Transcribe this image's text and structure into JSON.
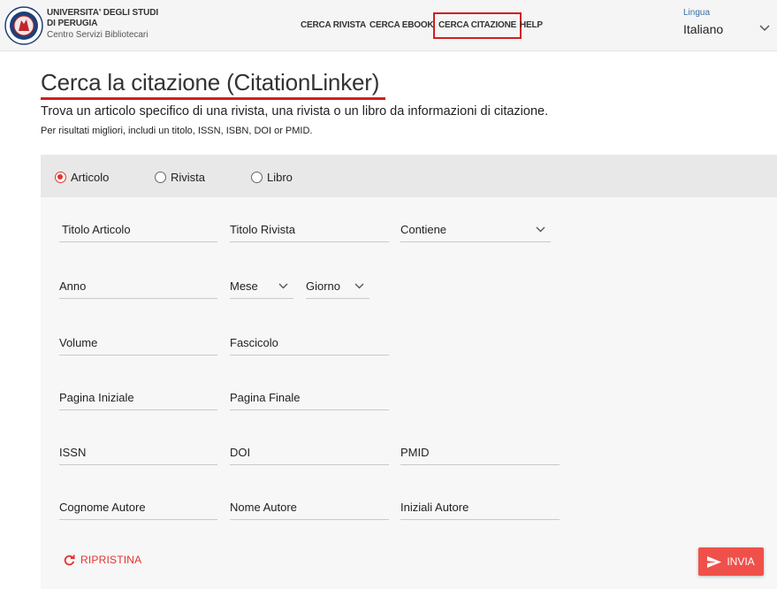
{
  "header": {
    "brand_line1": "UNIVERSITA' DEGLI STUDI",
    "brand_line2": "DI PERUGIA",
    "brand_line3": "Centro Servizi Bibliotecari",
    "nav": [
      {
        "label": "CERCA RIVISTA",
        "active": false
      },
      {
        "label": "CERCA EBOOK",
        "active": false
      },
      {
        "label": "CERCA CITAZIONE",
        "active": true
      },
      {
        "label": "HELP",
        "active": false
      }
    ],
    "language_label": "Lingua",
    "language_value": "Italiano"
  },
  "page": {
    "title": "Cerca la citazione (CitationLinker)",
    "subtitle": "Trova un articolo specifico di una rivista, una rivista o un libro da informazioni di citazione.",
    "hint": "Per risultati migliori, includi un titolo, ISSN, ISBN, DOI or PMID."
  },
  "form": {
    "types": [
      {
        "label": "Articolo",
        "selected": true
      },
      {
        "label": "Rivista",
        "selected": false
      },
      {
        "label": "Libro",
        "selected": false
      }
    ],
    "fields": {
      "titolo_articolo": "Titolo Articolo",
      "titolo_rivista": "Titolo Rivista",
      "contiene": "Contiene",
      "anno": "Anno",
      "mese": "Mese",
      "giorno": "Giorno",
      "volume": "Volume",
      "fascicolo": "Fascicolo",
      "pagina_iniziale": "Pagina Iniziale",
      "pagina_finale": "Pagina Finale",
      "issn": "ISSN",
      "doi": "DOI",
      "pmid": "PMID",
      "cognome_autore": "Cognome Autore",
      "nome_autore": "Nome Autore",
      "iniziali_autore": "Iniziali Autore"
    },
    "reset_label": "RIPRISTINA",
    "submit_label": "INVIA"
  },
  "colors": {
    "accent": "#e3342f",
    "header_bg": "#f5f5f5",
    "card_bg": "#f7f7f7"
  }
}
